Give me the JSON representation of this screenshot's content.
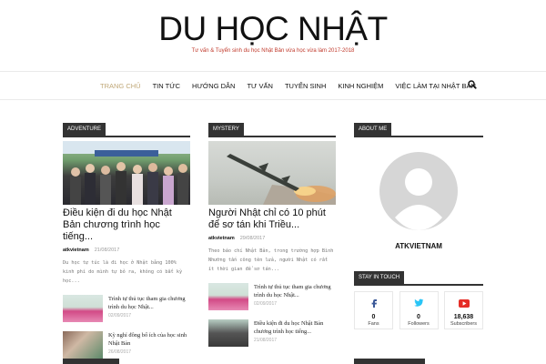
{
  "header": {
    "logo": "DU HỌC NHẬT",
    "tagline": "Tư vấn & Tuyển sinh du học Nhật Bản vừa học vừa làm 2017-2018"
  },
  "nav": {
    "items": [
      "TRANG CHỦ",
      "TIN TỨC",
      "HƯỚNG DẪN",
      "TƯ VẤN",
      "TUYỂN SINH",
      "KINH NGHIỆM",
      "VIỆC LÀM TẠI NHẬT BẢN"
    ],
    "active": "TRANG CHỦ"
  },
  "col1": {
    "label": "ADVENTURE",
    "title": "Điều kiện đi du học Nhật Bản chương trình học tiếng...",
    "author": "atkvietnam",
    "date": "21/08/2017",
    "excerpt": "Du học tự túc là đi học ở Nhật bằng 100% kinh phí do mình tự bỏ ra, không có bất kỳ học...",
    "small": [
      {
        "title": "Trình tự thủ tục tham gia chương trình du học Nhật...",
        "date": "02/09/2017"
      },
      {
        "title": "Kỳ nghỉ đông bổ ích của học sinh Nhật Bản",
        "date": "26/08/2017"
      }
    ]
  },
  "col2": {
    "label": "MYSTERY",
    "title": "Người Nhật chỉ có 10 phút để sơ tán khi Triều...",
    "author": "atkvietnam",
    "date": "29/08/2017",
    "excerpt": "Theo báo chí Nhật Bản, trong trường hợp Bình Nhưỡng tấn công tên lửa, người Nhật có rất ít thời gian để sơ tán...",
    "small": [
      {
        "title": "Trình tự thủ tục tham gia chương trình du học Nhật...",
        "date": "02/09/2017"
      },
      {
        "title": "Điều kiện đi du học Nhật Bản chương trình học tiếng...",
        "date": "21/08/2017"
      }
    ]
  },
  "sidebar": {
    "about_label": "ABOUT ME",
    "author_name": "ATKVIETNAM",
    "stay_label": "STAY IN TOUCH",
    "social": [
      {
        "icon": "facebook-icon",
        "count": "0",
        "label": "Fans",
        "color": "#3b5998"
      },
      {
        "icon": "twitter-icon",
        "count": "0",
        "label": "Followers",
        "color": "#29c5f6"
      },
      {
        "icon": "youtube-icon",
        "count": "18,638",
        "label": "Subscribers",
        "color": "#e52d27"
      }
    ]
  },
  "colors": {
    "accent": "#c0a878",
    "block": "#333333",
    "tagline": "#c0392b"
  }
}
